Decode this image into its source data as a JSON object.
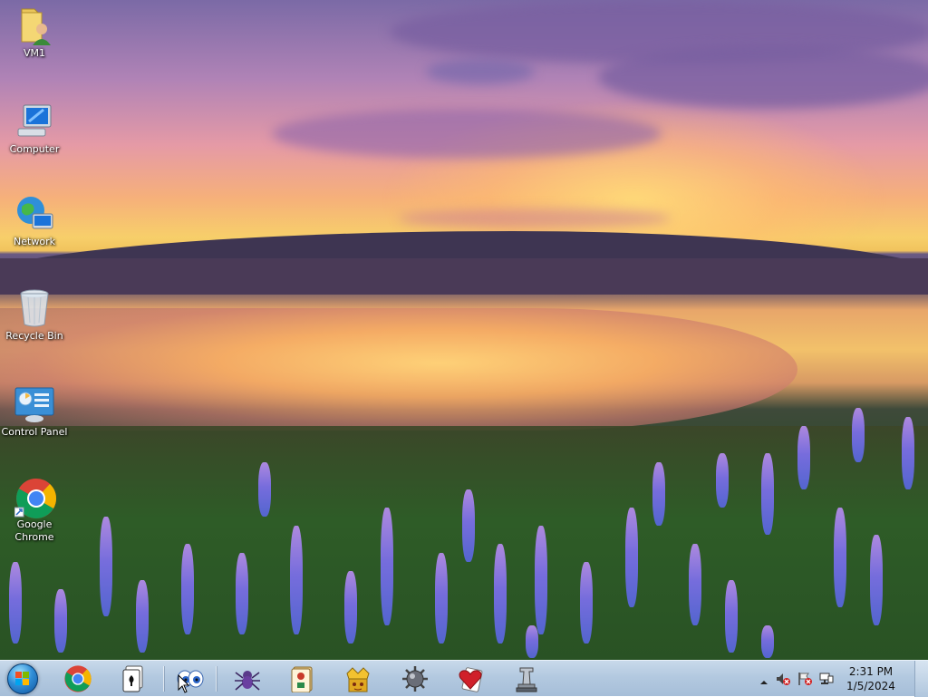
{
  "desktop": {
    "icons": [
      {
        "label": "VM1"
      },
      {
        "label": "Computer"
      },
      {
        "label": "Network"
      },
      {
        "label": "Recycle Bin"
      },
      {
        "label": "Control Panel"
      },
      {
        "label": "Google Chrome"
      }
    ]
  },
  "taskbar": {
    "start": {
      "icon": "windows-orb-icon"
    },
    "pinned": [
      {
        "name": "chrome",
        "icon": "chrome-icon"
      },
      {
        "name": "solitaire",
        "icon": "solitaire-icon"
      },
      {
        "name": "purble-place",
        "icon": "purble-place-icon"
      },
      {
        "name": "spider-solitaire",
        "icon": "spider-solitaire-icon"
      },
      {
        "name": "mahjong-titans",
        "icon": "mahjong-titans-icon"
      },
      {
        "name": "freecell",
        "icon": "freecell-icon"
      },
      {
        "name": "minesweeper",
        "icon": "minesweeper-icon"
      },
      {
        "name": "hearts",
        "icon": "hearts-icon"
      },
      {
        "name": "chess-titans",
        "icon": "chess-titans-icon"
      }
    ],
    "tray": {
      "clock_time": "2:31 PM",
      "clock_date": "1/5/2024"
    }
  },
  "colors": {
    "taskbar_top": "#c8d9ea",
    "taskbar_bottom": "#a6bed8",
    "icon_label": "#ffffff"
  }
}
